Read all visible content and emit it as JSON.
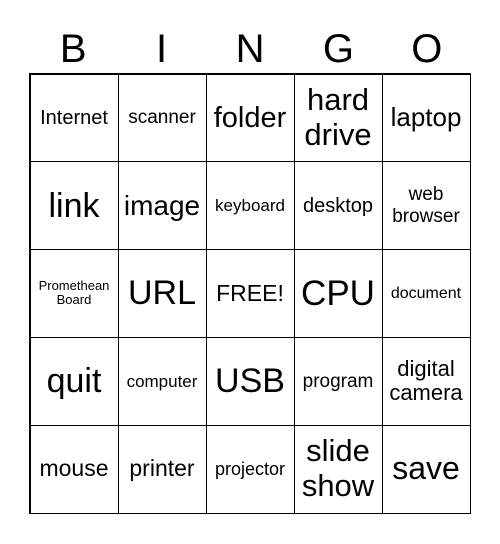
{
  "header": {
    "letters": [
      "B",
      "I",
      "N",
      "G",
      "O"
    ]
  },
  "cells": [
    [
      "Internet",
      "scanner",
      "folder",
      "hard\ndrive",
      "laptop"
    ],
    [
      "link",
      "image",
      "keyboard",
      "desktop",
      "web\nbrowser"
    ],
    [
      "Promethean\nBoard",
      "URL",
      "FREE!",
      "CPU",
      "document"
    ],
    [
      "quit",
      "computer",
      "USB",
      "program",
      "digital\ncamera"
    ],
    [
      "mouse",
      "printer",
      "projector",
      "slide\nshow",
      "save"
    ]
  ]
}
